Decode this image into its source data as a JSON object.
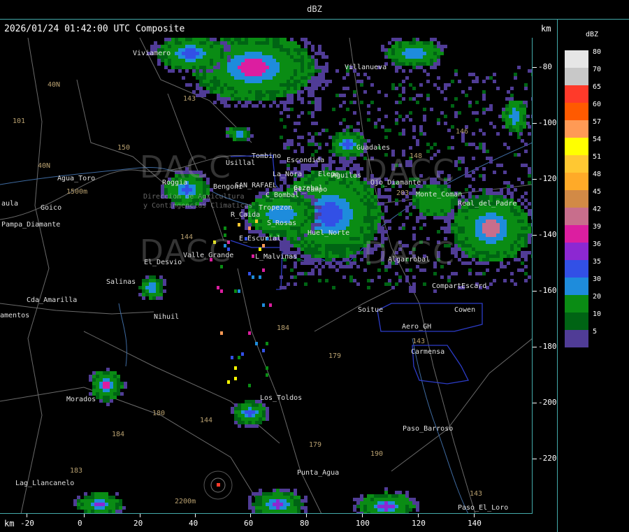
{
  "header": {
    "title": "dBZ"
  },
  "map": {
    "subtitle": "2026/01/24 01:42:00 UTC Composite",
    "unit_top": "km",
    "unit_bottom": "km",
    "y_ticks": [
      "-80",
      "-100",
      "-120",
      "-140",
      "-160",
      "-180",
      "-200",
      "-220"
    ],
    "x_ticks": [
      "-20",
      "0",
      "20",
      "40",
      "60",
      "80",
      "100",
      "120",
      "140"
    ],
    "places": [
      "Viviamero",
      "Villanueva",
      "Tombino",
      "Usillal",
      "Escondida",
      "La_Nora",
      "Elepe",
      "Guadales",
      "Aguilas",
      "Bengoni",
      "SAN_RAFAEL",
      "Roggia",
      "Gazabal",
      "C_Bombal",
      "Tropezon",
      "R_Caida",
      "S_Rosas",
      "Huel_Norte",
      "E_Escurial",
      "Valle_Grande",
      "L_Malvinas",
      "El_Desvio",
      "Salinas",
      "Cda_Amarilla",
      "Nihuil",
      "Soitue",
      "Aero_GH",
      "Cowen",
      "CompartEscard",
      "Carmensa",
      "Morados",
      "Los_Toldos",
      "Paso_Barroso",
      "Punta_Agua",
      "Lag_Llancanelo",
      "Paso_El_Loro",
      "Agua_Toro",
      "Pampa_Diamante",
      "Goico",
      "El_Campo",
      "Monte_Coman",
      "Real_del_Padre",
      "Ojo_Diamante",
      "Algarrobal",
      "amentos",
      "aula"
    ],
    "numbers": [
      "40N",
      "101",
      "143",
      "150",
      "40N",
      "203",
      "146",
      "148",
      "144",
      "144",
      "179",
      "184",
      "180",
      "184",
      "183",
      "179",
      "190",
      "143",
      "143",
      "1500m",
      "2200m"
    ],
    "watermark": [
      "DACC",
      "DACC",
      "DACC",
      "DACC"
    ],
    "watermark_sub": [
      "Direccion de Agricultura",
      "y Contingencias Climaticas"
    ]
  },
  "legend": {
    "title": "dBZ",
    "levels": [
      {
        "label": "80",
        "color": "#e6e6e6"
      },
      {
        "label": "70",
        "color": "#c8c8c8"
      },
      {
        "label": "65",
        "color": "#ff3a2a"
      },
      {
        "label": "60",
        "color": "#ff5a00"
      },
      {
        "label": "57",
        "color": "#ff9a55"
      },
      {
        "label": "54",
        "color": "#ffff00"
      },
      {
        "label": "51",
        "color": "#ffc832"
      },
      {
        "label": "48",
        "color": "#ffaa28"
      },
      {
        "label": "45",
        "color": "#d28a46"
      },
      {
        "label": "42",
        "color": "#c86e8c"
      },
      {
        "label": "39",
        "color": "#dc1ea0"
      },
      {
        "label": "36",
        "color": "#8c28d2"
      },
      {
        "label": "35",
        "color": "#3250e6"
      },
      {
        "label": "30",
        "color": "#1e8cdc"
      },
      {
        "label": "20",
        "color": "#0a8c14"
      },
      {
        "label": "10",
        "color": "#006414"
      },
      {
        "label": "5",
        "color": "#503c96"
      }
    ]
  }
}
